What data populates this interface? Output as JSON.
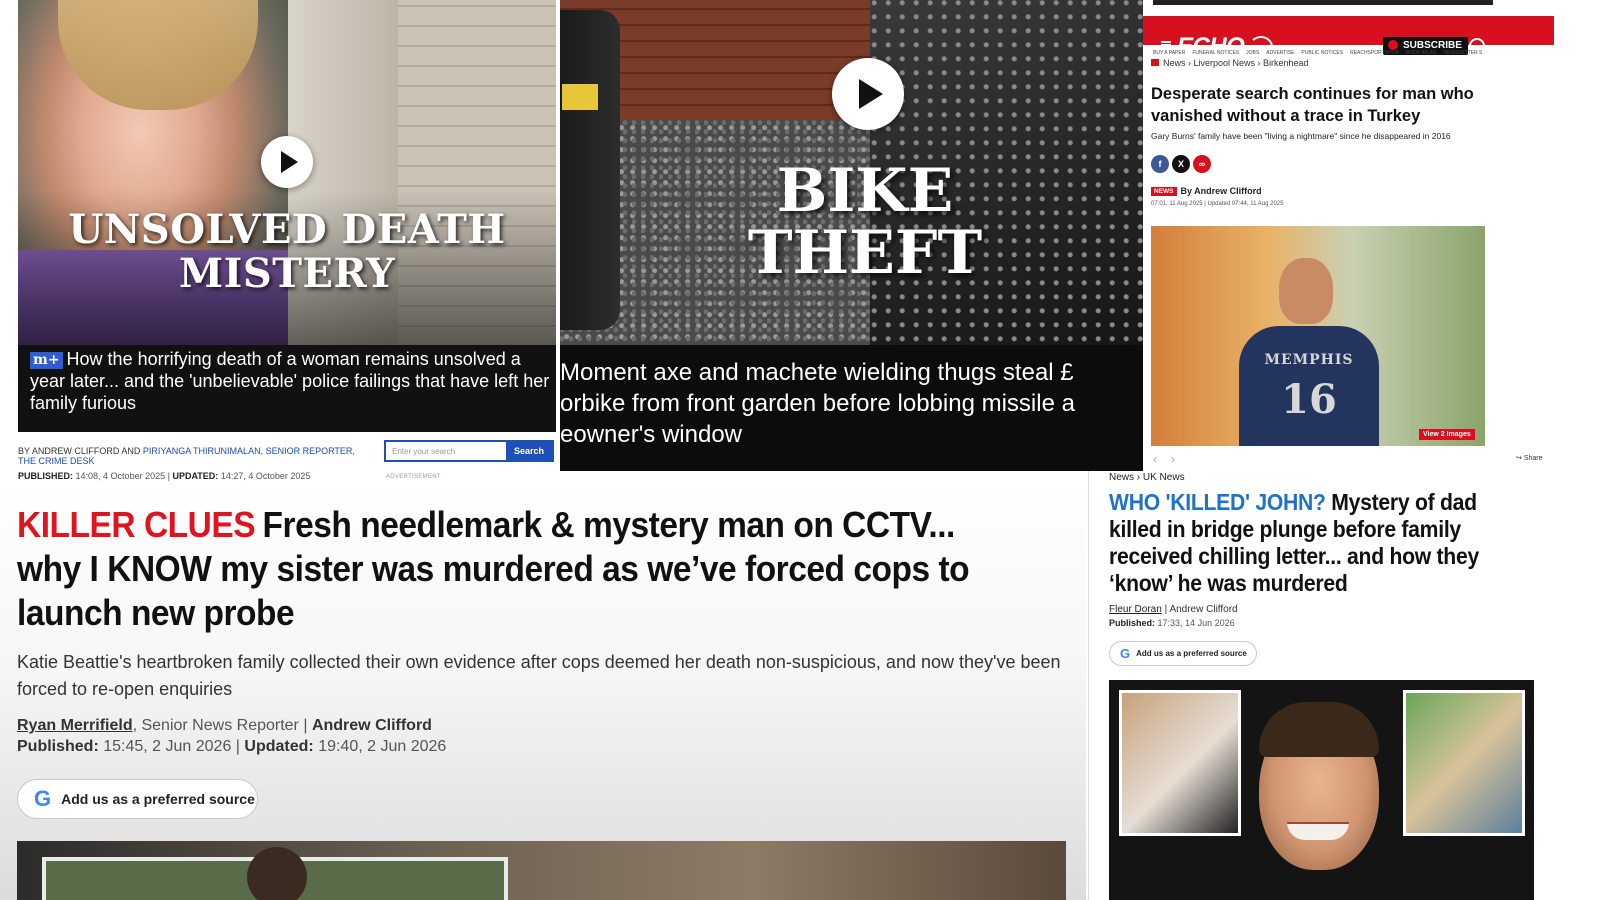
{
  "panel_dailymail": {
    "overlay_title": "UNSOLVED DEATH MISTERY",
    "badge": "m+",
    "caption": "How the horrifying death of a woman remains unsolved a year later... and the 'unbelievable' police failings that have left her family furious",
    "byline_prefix": "By ANDREW CLIFFORD and",
    "byline_link": "PIRIYANGA THIRUNIMALAN, SENIOR REPORTER, THE CRIME DESK",
    "published_label": "PUBLISHED:",
    "published_value": "14:08, 4 October 2025",
    "updated_label": "UPDATED:",
    "updated_value": "14:27, 4 October 2025",
    "search_placeholder": "Enter your search",
    "search_button": "Search",
    "ad_label": "ADVERTISEMENT"
  },
  "panel_bike": {
    "overlay_title": "BIKE THEFT",
    "caption_lines": [
      "Moment axe and machete wielding thugs steal £",
      "orbike from front garden before lobbing missile a",
      "eowner's window"
    ]
  },
  "panel_echo": {
    "logo": "ECHO",
    "subscribe": "SUBSCRIBE",
    "nav_links": [
      "BUY A PAPER",
      "FUNERAL NOTICES",
      "JOBS",
      "ADVERTISE",
      "PUBLIC NOTICES",
      "REACHSPORTSHOP",
      "BOOK AN AD",
      "NEWSLETTER S"
    ],
    "breadcrumb": "News › Liverpool News › Birkenhead",
    "headline": "Desperate search continues for man who vanished without a trace in Turkey",
    "dek": "Gary Burns' family have been \"living a nightmare\" since he disappeared in 2016",
    "section_badge": "NEWS",
    "byline": "By Andrew Clifford",
    "dates": "07:01, 11 Aug 2025   |   Updated 07:44, 11 Aug 2025",
    "jersey_team": "MEMPHIS",
    "jersey_number": "16",
    "view_images": "View 2 Images",
    "share_label": "Share"
  },
  "panel_sun": {
    "kicker": "KILLER CLUES",
    "headline": "Fresh needlemark & mystery man on CCTV... why I KNOW my sister was murdered as we’ve forced cops to launch new probe",
    "dek": "Katie Beattie's heartbroken family collected their own evidence after cops deemed her death non-suspicious, and now they've been forced to re-open enquiries",
    "author1": "Ryan Merrifield",
    "author1_role": ", Senior News Reporter",
    "separator": "|",
    "author2": "Andrew Clifford",
    "published_label": "Published:",
    "published_value": "15:45, 2 Jun 2026",
    "updated_label": "Updated:",
    "updated_value": "19:40, 2 Jun 2026",
    "preferred_source": "Add us as a preferred source"
  },
  "panel_john": {
    "breadcrumb": "News › UK News",
    "kicker": "WHO 'KILLED' JOHN?",
    "headline": "Mystery of dad killed in bridge plunge before family received chilling letter... and how they ‘know’ he was murdered",
    "author1": "Fleur Doran",
    "separator": "|",
    "author2": "Andrew Clifford",
    "published_label": "Published:",
    "published_value": "17:33, 14 Jun 2026",
    "preferred_source": "Add us as a preferred source"
  }
}
